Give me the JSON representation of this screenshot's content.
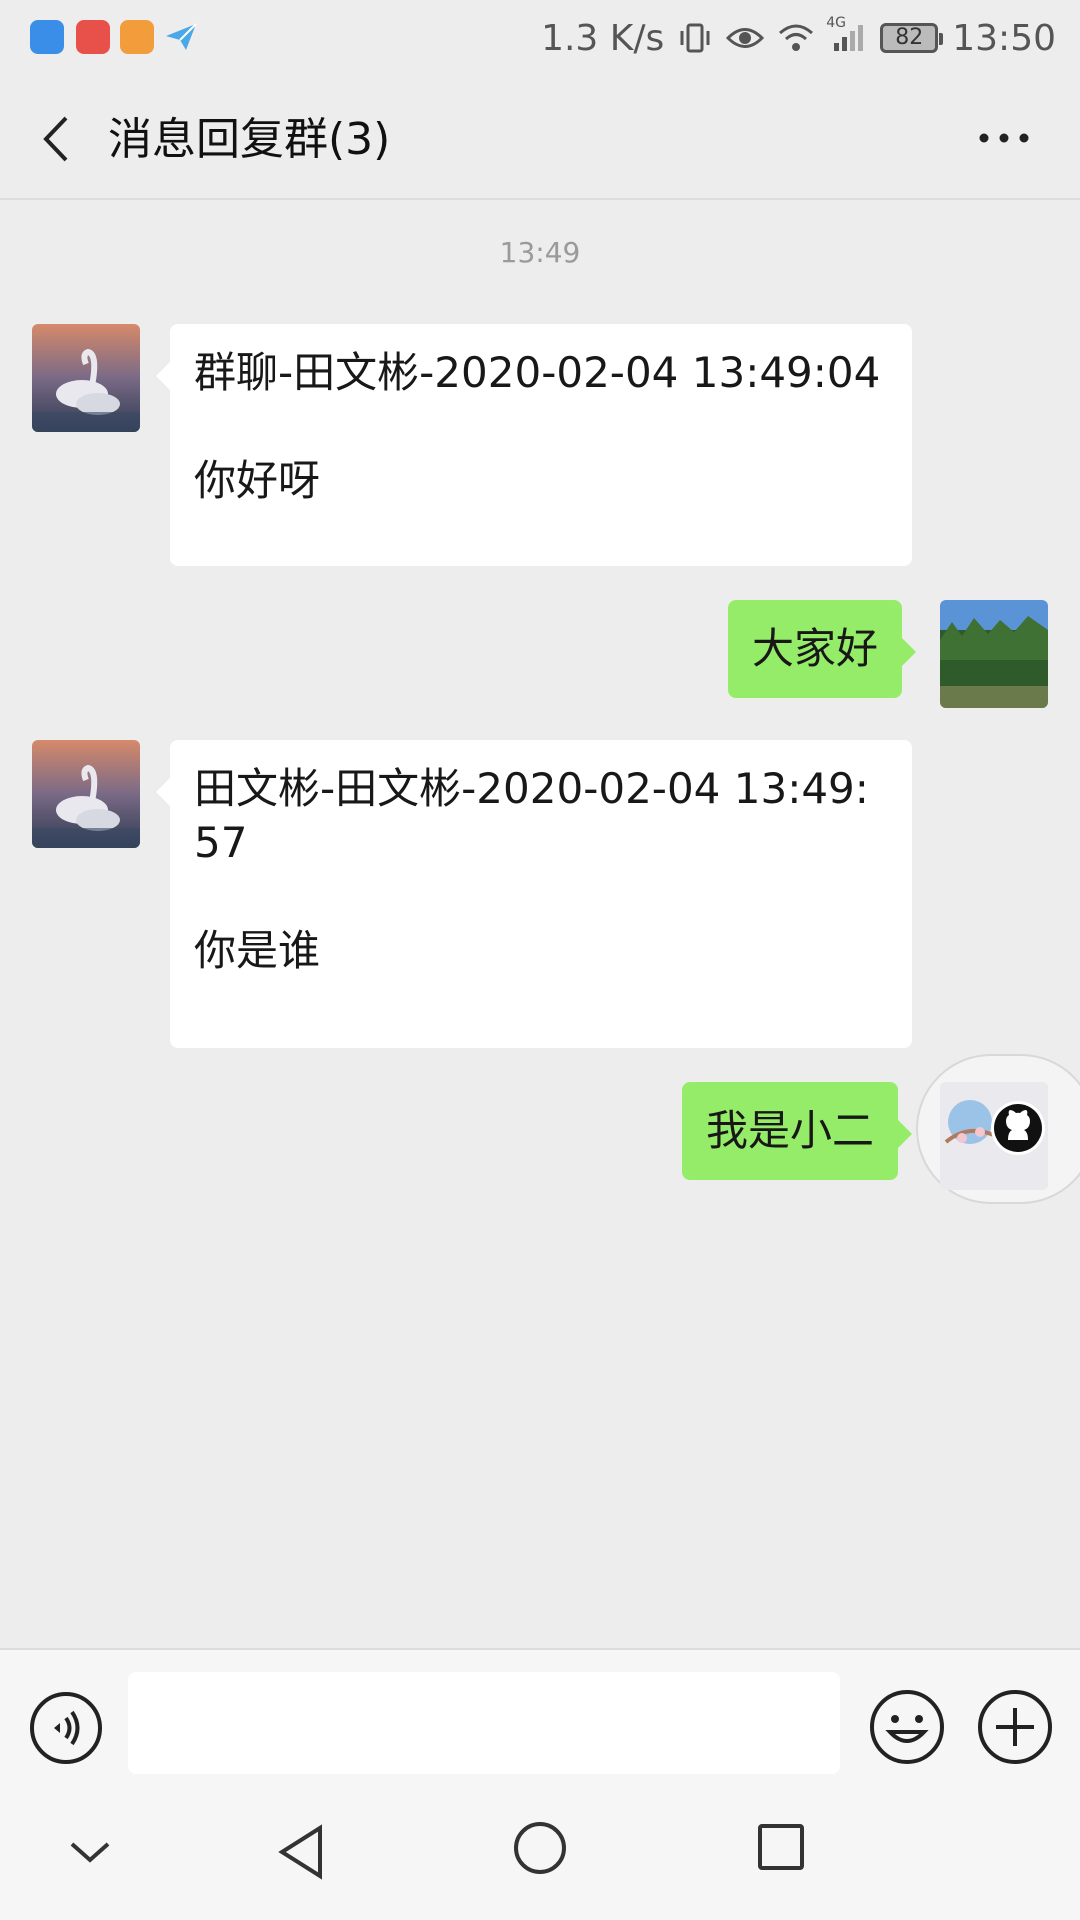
{
  "status_bar": {
    "net_speed": "1.3 K/s",
    "network": "4G",
    "battery": "82",
    "time": "13:50",
    "app_icons": [
      {
        "name": "security-app-icon",
        "color": "#3a8ee8"
      },
      {
        "name": "red-app-icon",
        "color": "#e8504a"
      },
      {
        "name": "video-player-icon",
        "color": "#f39c3c"
      },
      {
        "name": "paper-plane-icon",
        "color": "#4aa8e8"
      }
    ]
  },
  "header": {
    "title": "消息回复群(3)"
  },
  "chat": {
    "time_separator": "13:49",
    "messages": [
      {
        "side": "left",
        "avatar": "swan-avatar",
        "text": "群聊-田文彬-2020-02-04 13:49:04\n\n你好呀"
      },
      {
        "side": "right",
        "avatar": "forest-avatar",
        "text": "大家好"
      },
      {
        "side": "left",
        "avatar": "swan-avatar",
        "text": "田文彬-田文彬-2020-02-04 13:49:57\n\n你是谁"
      },
      {
        "side": "right",
        "avatar": "blossom-avatar",
        "text": "我是小二"
      }
    ]
  },
  "colors": {
    "self_bubble": "#95ec69",
    "other_bubble": "#ffffff",
    "background": "#ededed"
  }
}
